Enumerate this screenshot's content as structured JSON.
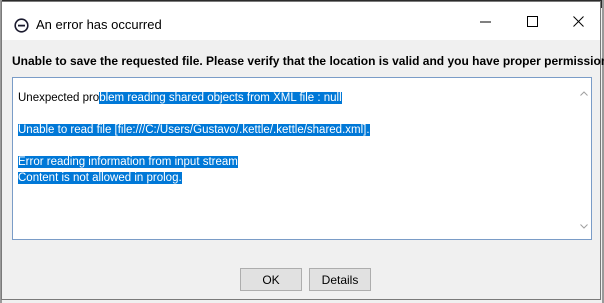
{
  "window": {
    "title": "An error has occurred"
  },
  "dialog": {
    "header_message": "Unable to save the requested file. Please verify that the location is valid and you have proper permissions.",
    "details": {
      "line1_unselected": "Unexpected pro",
      "line1_selected": "blem reading shared objects from XML file : null",
      "line2": "Unable to read file [file:///C:/Users/Gustavo/.kettle/.kettle/shared.xml].",
      "line3": "Error reading information from input stream",
      "line4": "Content is not allowed in prolog."
    },
    "buttons": {
      "ok_label": "OK",
      "details_label": "Details"
    }
  },
  "colors": {
    "selection": "#0078d7",
    "dialog_bg": "#f0f0f0"
  },
  "icons": {
    "title": "minus-circle-icon",
    "minimize": "minimize-icon",
    "maximize": "maximize-icon",
    "close": "close-icon"
  }
}
